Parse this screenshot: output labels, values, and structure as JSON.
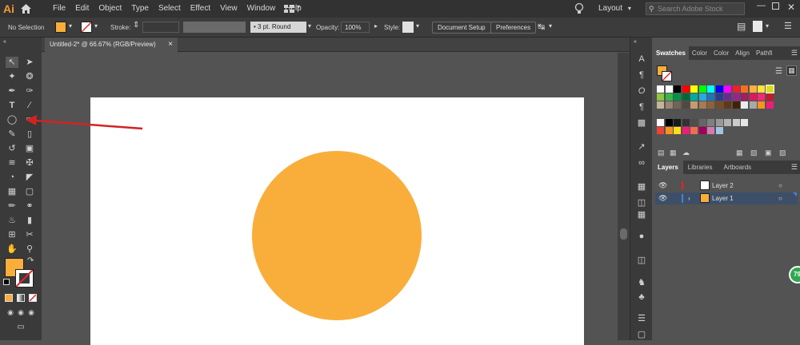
{
  "app": {
    "logo": "Ai",
    "brand_color": "#f39c2b"
  },
  "menu": {
    "items": [
      "File",
      "Edit",
      "Object",
      "Type",
      "Select",
      "Effect",
      "View",
      "Window",
      "Help"
    ]
  },
  "workspace": {
    "layout_label": "Layout",
    "search_placeholder": "Search Adobe Stock"
  },
  "control_bar": {
    "selection_label": "No Selection",
    "fill_color": "#f9ae3c",
    "stroke_label": "Stroke:",
    "brush_label": "3 pt. Round",
    "opacity_label": "Opacity:",
    "opacity_value": "100%",
    "style_label": "Style:",
    "document_setup_label": "Document Setup",
    "preferences_label": "Preferences"
  },
  "document": {
    "tab_title": "Untitled-2* @ 66.67% (RGB/Preview)",
    "close_glyph": "×"
  },
  "canvas": {
    "circle_color": "#f9ae3c",
    "arrow_color": "#d42222"
  },
  "tools": {
    "fill_color": "#f9ae3c"
  },
  "swatches_panel": {
    "tabs": [
      "Swatches",
      "Color",
      "Color",
      "Align",
      "Pathfi"
    ],
    "rows": [
      [
        "#ffffff",
        "#ffffff",
        "#000000",
        "#ff0000",
        "#ffff00",
        "#00ff00",
        "#00ffff",
        "#0000ff",
        "#ff00ff",
        "#e8232a",
        "#f36f21",
        "#fbb040",
        "#ffe23a",
        "#d7df23"
      ],
      [
        "#8dc63f",
        "#39b54a",
        "#009444",
        "#006838",
        "#00a99d",
        "#27aae1",
        "#1c75bc",
        "#2b3990",
        "#662d91",
        "#92278f",
        "#9e1f63",
        "#da1c5c",
        "#ee2a7b",
        "#be1e2d"
      ],
      [
        "#c2b59b",
        "#998675",
        "#736357",
        "#534741",
        "#c69c6d",
        "#a67c52",
        "#8c6239",
        "#754c24",
        "#603913",
        "#42210b",
        "#ebebeb",
        "#a7a9ac",
        "#f7941d",
        "#ed1e79"
      ],
      [
        "#ffffff",
        "#000000",
        "#1a1a1a",
        "#333333",
        "#4d4d4d",
        "#666666",
        "#808080",
        "#999999",
        "#b3b3b3",
        "#cccccc",
        "#e6e6e6"
      ],
      [
        "#ef4136",
        "#f7941d",
        "#ffde17",
        "#ed1e79",
        "#f26c4f",
        "#9e005d",
        "#d37bb1",
        "#9fc5e8"
      ]
    ]
  },
  "layers_panel": {
    "tabs": [
      "Layers",
      "Libraries",
      "Artboards"
    ],
    "layers": [
      {
        "name": "Layer 2",
        "color": "#e8232a",
        "thumb": "#ffffff"
      },
      {
        "name": "Layer 1",
        "color": "#4a7fd4",
        "thumb": "#f9ae3c"
      }
    ]
  },
  "badge": {
    "text": "79"
  }
}
